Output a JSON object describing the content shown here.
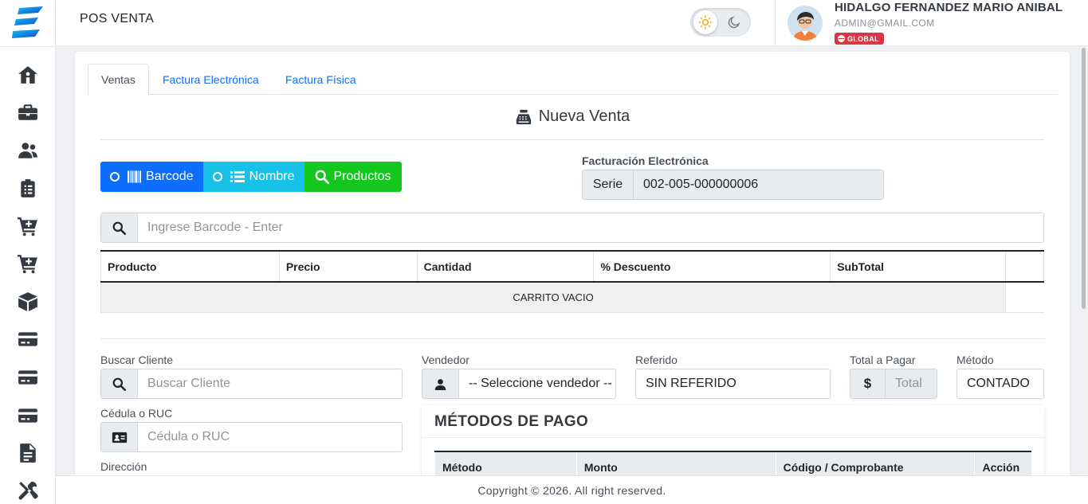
{
  "header": {
    "app_title": "POS VENTA",
    "user_name": "HIDALGO FERNANDEZ MARIO ANIBAL",
    "user_email": "ADMIN@GMAIL.COM",
    "role_badge": "GLOBAL"
  },
  "sidebar": {
    "items": [
      {
        "icon": "home-icon"
      },
      {
        "icon": "briefcase-icon"
      },
      {
        "icon": "users-icon"
      },
      {
        "icon": "clipboard-icon"
      },
      {
        "icon": "cart-plus-icon"
      },
      {
        "icon": "cart-plus-icon"
      },
      {
        "icon": "box-icon"
      },
      {
        "icon": "credit-card-icon"
      },
      {
        "icon": "credit-card-icon"
      },
      {
        "icon": "credit-card-icon"
      },
      {
        "icon": "document-icon"
      },
      {
        "icon": "tools-icon"
      }
    ]
  },
  "tabs": [
    {
      "label": "Ventas",
      "active": true
    },
    {
      "label": "Factura Electrónica",
      "active": false
    },
    {
      "label": "Factura Física",
      "active": false
    }
  ],
  "section_title": "Nueva Venta",
  "search_modes": {
    "barcode": "Barcode",
    "nombre": "Nombre",
    "productos": "Productos"
  },
  "facturacion": {
    "label": "Facturación Electrónica",
    "serie_label": "Serie",
    "serie_value": "002-005-000000006"
  },
  "barcode_input": {
    "placeholder": "Ingrese Barcode - Enter"
  },
  "cart_table": {
    "headers": [
      "Producto",
      "Precio",
      "Cantidad",
      "% Descuento",
      "SubTotal"
    ],
    "empty_message": "CARRITO VACIO"
  },
  "form": {
    "buscar_cliente_label": "Buscar Cliente",
    "buscar_cliente_placeholder": "Buscar Cliente",
    "cedula_label": "Cédula o RUC",
    "cedula_placeholder": "Cédula o RUC",
    "direccion_label": "Dirección",
    "vendedor_label": "Vendedor",
    "vendedor_value": "-- Seleccione vendedor --",
    "referido_label": "Referido",
    "referido_value": "SIN REFERIDO",
    "total_label": "Total a Pagar",
    "total_addon": "$",
    "total_placeholder": "Total",
    "metodo_label": "Método",
    "metodo_value": "CONTADO"
  },
  "metodos_pago": {
    "title": "MÉTODOS DE PAGO",
    "headers": [
      "Método",
      "Monto",
      "Código / Comprobante",
      "Acción"
    ]
  },
  "footer": {
    "copyright": "Copyright © 2026. All right reserved."
  },
  "colors": {
    "barcode_btn": "#0d6efd",
    "nombre_btn": "#17c1e8",
    "productos_btn": "#14c71e",
    "badge": "#dc3545"
  }
}
